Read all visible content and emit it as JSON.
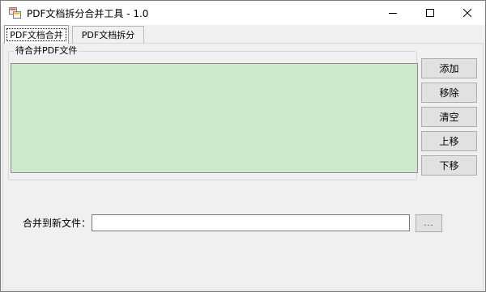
{
  "window": {
    "title": "PDF文档拆分合并工具 - 1.0"
  },
  "tabs": [
    {
      "label": "PDF文档合并",
      "active": true
    },
    {
      "label": "PDF文档拆分",
      "active": false
    }
  ],
  "merge_tab": {
    "group_label": "待合并PDF文件",
    "list_items": [],
    "list_background": "#cde8cd",
    "buttons": {
      "add": "添加",
      "remove": "移除",
      "clear": "清空",
      "up": "上移",
      "down": "下移"
    },
    "output": {
      "label": "合并到新文件：",
      "value": "",
      "browse_label": "..."
    }
  },
  "icons": {
    "app": "app-icon",
    "minimize": "minimize-icon",
    "maximize": "maximize-icon",
    "close": "close-icon"
  }
}
